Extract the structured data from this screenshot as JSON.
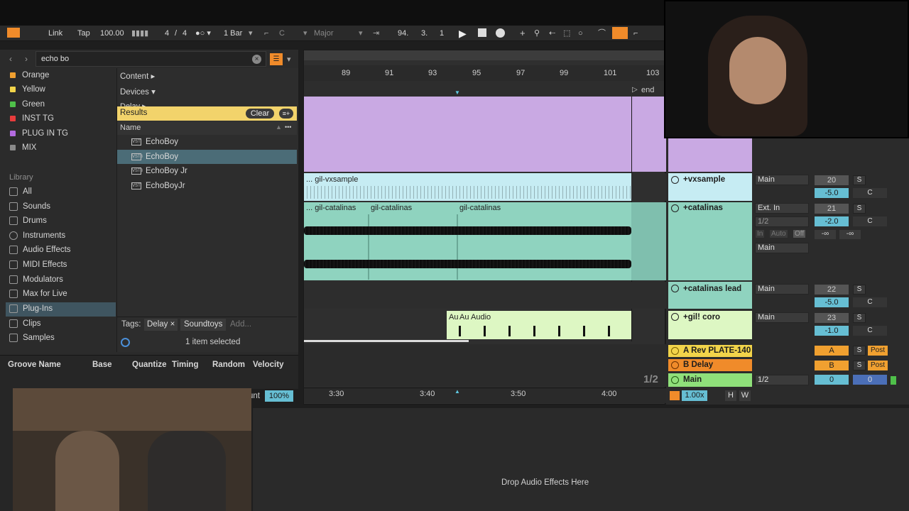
{
  "transport": {
    "link": "Link",
    "tap": "Tap",
    "tempo": "100.00",
    "signature_num": "4",
    "signature_sep": "/",
    "signature_den": "4",
    "quantize": "1 Bar",
    "key": "C",
    "scale": "Major",
    "position_bar": "94.",
    "position_beat": "3.",
    "position_sixteenth": "1"
  },
  "browser": {
    "search": "echo bo",
    "labels": [
      {
        "name": "Orange",
        "color": "#f0a030"
      },
      {
        "name": "Yellow",
        "color": "#f2d44a"
      },
      {
        "name": "Green",
        "color": "#4fc04a"
      },
      {
        "name": "INST TG",
        "color": "#e83c3c"
      },
      {
        "name": "PLUG IN TG",
        "color": "#b36be0"
      },
      {
        "name": "MIX",
        "color": "#8a8a8a"
      }
    ],
    "library_title": "Library",
    "library": [
      {
        "name": "All",
        "icon": "grid-icon"
      },
      {
        "name": "Sounds",
        "icon": "note-icon"
      },
      {
        "name": "Drums",
        "icon": "drum-grid-icon"
      },
      {
        "name": "Instruments",
        "icon": "clock-icon"
      },
      {
        "name": "Audio Effects",
        "icon": "audio-fx-icon"
      },
      {
        "name": "MIDI Effects",
        "icon": "midi-fx-icon"
      },
      {
        "name": "Modulators",
        "icon": "modulator-icon"
      },
      {
        "name": "Max for Live",
        "icon": "max-icon"
      },
      {
        "name": "Plug-Ins",
        "icon": "plugin-icon"
      },
      {
        "name": "Clips",
        "icon": "clip-icon"
      },
      {
        "name": "Samples",
        "icon": "wave-icon"
      }
    ],
    "content": "Content ▸",
    "devices": "Devices ▾",
    "delay_stub": "Delay ▸",
    "results": "Results",
    "clear": "Clear",
    "name_col": "Name",
    "items": [
      "EchoBoy",
      "EchoBoy",
      "EchoBoy Jr",
      "EchoBoyJr"
    ],
    "tags_label": "Tags:",
    "tags": [
      "Delay ×",
      "Soundtoys"
    ],
    "add": "Add...",
    "selected": "1 item selected"
  },
  "groove": {
    "headers": [
      "Groove Name",
      "Base",
      "Quantize",
      "Timing",
      "Random",
      "Velocity"
    ],
    "amount_label": "unt",
    "amount": "100%"
  },
  "arrangement": {
    "ruler": [
      "89",
      "91",
      "93",
      "95",
      "97",
      "99",
      "101",
      "103"
    ],
    "end": "end",
    "time_ruler": [
      "3:30",
      "3:40",
      "3:50",
      "4:00"
    ],
    "zoom": "1/2",
    "clips": {
      "vx": "... gil-vxsample",
      "cat1": "... gil-catalinas",
      "cat2": "gil-catalinas",
      "cat3": "gil-catalinas",
      "au1": "Au",
      "au2": "Au",
      "audio": "Audio"
    },
    "colors": {
      "purple": "#c9a9e3",
      "lightblue": "#c6ecf3",
      "teal": "#8fd3bf",
      "lightgreen": "#ddf7c3"
    }
  },
  "mixer": {
    "tracks": [
      {
        "name": "+vxsample",
        "route": "Main",
        "num": "20",
        "vol": "-5.0",
        "pan": "C",
        "color": "#c6ecf3"
      },
      {
        "name": "+catalinas",
        "route": "Ext. In",
        "route2": "1/2",
        "num": "21",
        "vol": "-2.0",
        "pan": "C",
        "color": "#8fd3bf",
        "monitor": [
          "In",
          "Auto",
          "Off"
        ],
        "out": "Main",
        "sends": [
          "-∞",
          "-∞"
        ]
      },
      {
        "name": "+catalinas lead",
        "route": "Main",
        "num": "22",
        "vol": "-5.0",
        "pan": "C",
        "color": "#8fd3bf"
      },
      {
        "name": "+gil! coro",
        "route": "Main",
        "num": "23",
        "vol": "-1.0",
        "pan": "C",
        "color": "#ddf7c3"
      }
    ],
    "returns": [
      {
        "name": "A Rev PLATE-140",
        "letter": "A",
        "color": "#f2d44a"
      },
      {
        "name": "B Delay",
        "letter": "B",
        "color": "#f08b2a"
      }
    ],
    "master": {
      "name": "Main",
      "route": "1/2",
      "val1": "0",
      "val2": "0",
      "color": "#8fe07a"
    },
    "solo": "S",
    "post": "Post",
    "tempo_scale": "1.00x",
    "h": "H",
    "w": "W"
  },
  "device_view": {
    "drop": "Drop Audio Effects Here"
  }
}
